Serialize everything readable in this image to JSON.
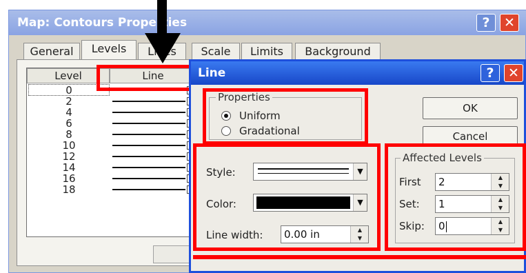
{
  "back_window": {
    "title": "Map: Contours Properties",
    "help_glyph": "?",
    "close_glyph": "✕",
    "tabs": [
      "General",
      "Levels",
      "Lines",
      "Scale",
      "Limits",
      "Background"
    ],
    "selected_tab": "Levels",
    "grid_headers": {
      "level": "Level",
      "line": "Line"
    },
    "levels": [
      "0",
      "2",
      "4",
      "6",
      "8",
      "10",
      "12",
      "14",
      "16",
      "18"
    ]
  },
  "line_dialog": {
    "title": "Line",
    "help_glyph": "?",
    "close_glyph": "✕",
    "properties": {
      "label": "Properties",
      "options": [
        "Uniform",
        "Gradational"
      ],
      "selected": "Uniform"
    },
    "buttons": {
      "ok": "OK",
      "cancel": "Cancel"
    },
    "style": {
      "label": "Style:",
      "value": "solid line"
    },
    "color": {
      "label": "Color:",
      "value": "#000000"
    },
    "line_width": {
      "label": "Line width:",
      "value": "0.00 in"
    },
    "affected_levels": {
      "label": "Affected Levels",
      "first": {
        "label": "First",
        "value": "2"
      },
      "set": {
        "label": "Set:",
        "value": "1"
      },
      "skip": {
        "label": "Skip:",
        "value": "0"
      }
    }
  },
  "annotation": {
    "highlight_color": "#ff0000",
    "arrow_color": "#000000"
  },
  "colors": {
    "dialog_title": "#1747c8",
    "back_title": "#8aa3e3",
    "close_button": "#e0442c"
  }
}
